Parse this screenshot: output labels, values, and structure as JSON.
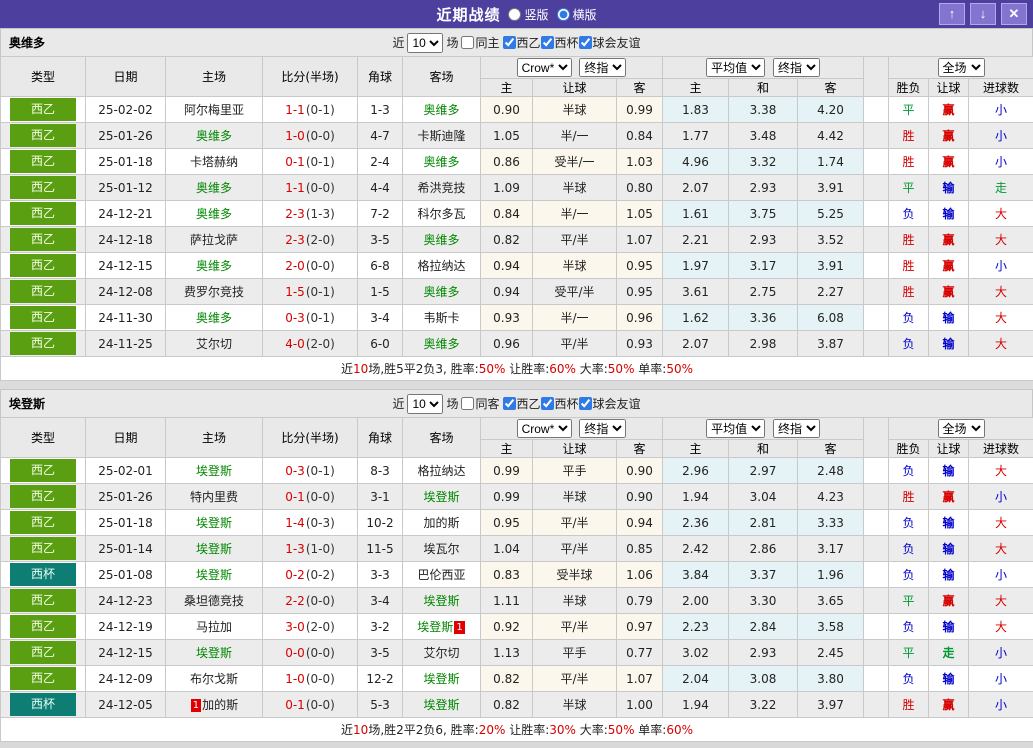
{
  "titlebar": {
    "title": "近期战绩",
    "layout_options": [
      {
        "label": "竖版",
        "selected": false
      },
      {
        "label": "横版",
        "selected": true
      }
    ],
    "buttons": {
      "up": "↑",
      "down": "↓",
      "close": "✕"
    }
  },
  "colors": {
    "header_purple": "#4c3f9e",
    "league_green": "#5a9e11",
    "league_cup_teal": "#0e7d74",
    "team_green": "#008800",
    "win_red": "#d70000",
    "lose_blue": "#0000cc",
    "draw_green": "#009933",
    "crow_columns_bg": "#fcf7ec",
    "avg_columns_bg": "#e6f3f6"
  },
  "columns": {
    "type": "类型",
    "date": "日期",
    "home": "主场",
    "score": "比分(半场)",
    "corner": "角球",
    "away": "客场",
    "crow_select": "Crow*",
    "final_select": "终指",
    "avg_select": "平均值",
    "final_select2": "终指",
    "full_select": "全场",
    "crow_sub": [
      "主",
      "让球",
      "客"
    ],
    "avg_sub": [
      "主",
      "和",
      "客"
    ],
    "full_sub": [
      "胜负",
      "让球",
      "进球数"
    ]
  },
  "tables": [
    {
      "team": "奥维多",
      "filter": {
        "prefix": "近",
        "count": "10",
        "suffix": "场",
        "same": {
          "label": "同主",
          "checked": false
        },
        "leagues": [
          {
            "label": "西乙",
            "checked": true
          },
          {
            "label": "西杯",
            "checked": true
          },
          {
            "label": "球会友谊",
            "checked": true
          }
        ]
      },
      "rows": [
        {
          "league": "西乙",
          "lc": "g",
          "date": "25-02-02",
          "home": {
            "name": "阿尔梅里亚"
          },
          "ft": "1-1",
          "ht": "(0-1)",
          "corners": "1-3",
          "away": {
            "name": "奥维多",
            "green": true
          },
          "crow": [
            "0.90",
            "半球",
            "0.99"
          ],
          "avg": [
            "1.83",
            "3.38",
            "4.20"
          ],
          "results": [
            [
              "平",
              "g"
            ],
            [
              "赢",
              "r"
            ],
            [
              "小",
              "b"
            ]
          ]
        },
        {
          "league": "西乙",
          "lc": "g",
          "date": "25-01-26",
          "home": {
            "name": "奥维多",
            "green": true
          },
          "ft": "1-0",
          "ht": "(0-0)",
          "corners": "4-7",
          "away": {
            "name": "卡斯迪隆"
          },
          "crow": [
            "1.05",
            "半/一",
            "0.84"
          ],
          "avg": [
            "1.77",
            "3.48",
            "4.42"
          ],
          "results": [
            [
              "胜",
              "r"
            ],
            [
              "赢",
              "r"
            ],
            [
              "小",
              "b"
            ]
          ]
        },
        {
          "league": "西乙",
          "lc": "g",
          "date": "25-01-18",
          "home": {
            "name": "卡塔赫纳"
          },
          "ft": "0-1",
          "ht": "(0-1)",
          "corners": "2-4",
          "away": {
            "name": "奥维多",
            "green": true
          },
          "crow": [
            "0.86",
            "受半/一",
            "1.03"
          ],
          "avg": [
            "4.96",
            "3.32",
            "1.74"
          ],
          "results": [
            [
              "胜",
              "r"
            ],
            [
              "赢",
              "r"
            ],
            [
              "小",
              "b"
            ]
          ]
        },
        {
          "league": "西乙",
          "lc": "g",
          "date": "25-01-12",
          "home": {
            "name": "奥维多",
            "green": true
          },
          "ft": "1-1",
          "ht": "(0-0)",
          "corners": "4-4",
          "away": {
            "name": "希洪竞技"
          },
          "crow": [
            "1.09",
            "半球",
            "0.80"
          ],
          "avg": [
            "2.07",
            "2.93",
            "3.91"
          ],
          "results": [
            [
              "平",
              "g"
            ],
            [
              "输",
              "b"
            ],
            [
              "走",
              "g"
            ]
          ]
        },
        {
          "league": "西乙",
          "lc": "g",
          "date": "24-12-21",
          "home": {
            "name": "奥维多",
            "green": true
          },
          "ft": "2-3",
          "ht": "(1-3)",
          "corners": "7-2",
          "away": {
            "name": "科尔多瓦"
          },
          "crow": [
            "0.84",
            "半/一",
            "1.05"
          ],
          "avg": [
            "1.61",
            "3.75",
            "5.25"
          ],
          "results": [
            [
              "负",
              "b"
            ],
            [
              "输",
              "b"
            ],
            [
              "大",
              "r"
            ]
          ]
        },
        {
          "league": "西乙",
          "lc": "g",
          "date": "24-12-18",
          "home": {
            "name": "萨拉戈萨"
          },
          "ft": "2-3",
          "ht": "(2-0)",
          "corners": "3-5",
          "away": {
            "name": "奥维多",
            "green": true
          },
          "crow": [
            "0.82",
            "平/半",
            "1.07"
          ],
          "avg": [
            "2.21",
            "2.93",
            "3.52"
          ],
          "results": [
            [
              "胜",
              "r"
            ],
            [
              "赢",
              "r"
            ],
            [
              "大",
              "r"
            ]
          ]
        },
        {
          "league": "西乙",
          "lc": "g",
          "date": "24-12-15",
          "home": {
            "name": "奥维多",
            "green": true
          },
          "ft": "2-0",
          "ht": "(0-0)",
          "corners": "6-8",
          "away": {
            "name": "格拉纳达"
          },
          "crow": [
            "0.94",
            "半球",
            "0.95"
          ],
          "avg": [
            "1.97",
            "3.17",
            "3.91"
          ],
          "results": [
            [
              "胜",
              "r"
            ],
            [
              "赢",
              "r"
            ],
            [
              "小",
              "b"
            ]
          ]
        },
        {
          "league": "西乙",
          "lc": "g",
          "date": "24-12-08",
          "home": {
            "name": "费罗尔竞技"
          },
          "ft": "1-5",
          "ht": "(0-1)",
          "corners": "1-5",
          "away": {
            "name": "奥维多",
            "green": true
          },
          "crow": [
            "0.94",
            "受平/半",
            "0.95"
          ],
          "avg": [
            "3.61",
            "2.75",
            "2.27"
          ],
          "results": [
            [
              "胜",
              "r"
            ],
            [
              "赢",
              "r"
            ],
            [
              "大",
              "r"
            ]
          ]
        },
        {
          "league": "西乙",
          "lc": "g",
          "date": "24-11-30",
          "home": {
            "name": "奥维多",
            "green": true
          },
          "ft": "0-3",
          "ht": "(0-1)",
          "corners": "3-4",
          "away": {
            "name": "韦斯卡"
          },
          "crow": [
            "0.93",
            "半/一",
            "0.96"
          ],
          "avg": [
            "1.62",
            "3.36",
            "6.08"
          ],
          "results": [
            [
              "负",
              "b"
            ],
            [
              "输",
              "b"
            ],
            [
              "大",
              "r"
            ]
          ]
        },
        {
          "league": "西乙",
          "lc": "g",
          "date": "24-11-25",
          "home": {
            "name": "艾尔切"
          },
          "ft": "4-0",
          "ht": "(2-0)",
          "corners": "6-0",
          "away": {
            "name": "奥维多",
            "green": true
          },
          "crow": [
            "0.96",
            "平/半",
            "0.93"
          ],
          "avg": [
            "2.07",
            "2.98",
            "3.87"
          ],
          "results": [
            [
              "负",
              "b"
            ],
            [
              "输",
              "b"
            ],
            [
              "大",
              "r"
            ]
          ]
        }
      ],
      "summary": [
        [
          "近",
          0
        ],
        [
          "10",
          1
        ],
        [
          "场,胜5平2负3, 胜率:",
          0
        ],
        [
          "50%",
          1
        ],
        [
          " 让胜率:",
          0
        ],
        [
          "60%",
          1
        ],
        [
          " 大率:",
          0
        ],
        [
          "50%",
          1
        ],
        [
          " 单率:",
          0
        ],
        [
          "50%",
          1
        ]
      ]
    },
    {
      "team": "埃登斯",
      "filter": {
        "prefix": "近",
        "count": "10",
        "suffix": "场",
        "same": {
          "label": "同客",
          "checked": false
        },
        "leagues": [
          {
            "label": "西乙",
            "checked": true
          },
          {
            "label": "西杯",
            "checked": true
          },
          {
            "label": "球会友谊",
            "checked": true
          }
        ]
      },
      "rows": [
        {
          "league": "西乙",
          "lc": "g",
          "date": "25-02-01",
          "home": {
            "name": "埃登斯",
            "green": true
          },
          "ft": "0-3",
          "ht": "(0-1)",
          "corners": "8-3",
          "away": {
            "name": "格拉纳达"
          },
          "crow": [
            "0.99",
            "平手",
            "0.90"
          ],
          "avg": [
            "2.96",
            "2.97",
            "2.48"
          ],
          "results": [
            [
              "负",
              "b"
            ],
            [
              "输",
              "b"
            ],
            [
              "大",
              "r"
            ]
          ]
        },
        {
          "league": "西乙",
          "lc": "g",
          "date": "25-01-26",
          "home": {
            "name": "特内里费"
          },
          "ft": "0-1",
          "ht": "(0-0)",
          "corners": "3-1",
          "away": {
            "name": "埃登斯",
            "green": true
          },
          "crow": [
            "0.99",
            "半球",
            "0.90"
          ],
          "avg": [
            "1.94",
            "3.04",
            "4.23"
          ],
          "results": [
            [
              "胜",
              "r"
            ],
            [
              "赢",
              "r"
            ],
            [
              "小",
              "b"
            ]
          ]
        },
        {
          "league": "西乙",
          "lc": "g",
          "date": "25-01-18",
          "home": {
            "name": "埃登斯",
            "green": true
          },
          "ft": "1-4",
          "ht": "(0-3)",
          "corners": "10-2",
          "away": {
            "name": "加的斯"
          },
          "crow": [
            "0.95",
            "平/半",
            "0.94"
          ],
          "avg": [
            "2.36",
            "2.81",
            "3.33"
          ],
          "results": [
            [
              "负",
              "b"
            ],
            [
              "输",
              "b"
            ],
            [
              "大",
              "r"
            ]
          ]
        },
        {
          "league": "西乙",
          "lc": "g",
          "date": "25-01-14",
          "home": {
            "name": "埃登斯",
            "green": true
          },
          "ft": "1-3",
          "ht": "(1-0)",
          "corners": "11-5",
          "away": {
            "name": "埃瓦尔"
          },
          "crow": [
            "1.04",
            "平/半",
            "0.85"
          ],
          "avg": [
            "2.42",
            "2.86",
            "3.17"
          ],
          "results": [
            [
              "负",
              "b"
            ],
            [
              "输",
              "b"
            ],
            [
              "大",
              "r"
            ]
          ]
        },
        {
          "league": "西杯",
          "lc": "t",
          "date": "25-01-08",
          "home": {
            "name": "埃登斯",
            "green": true
          },
          "ft": "0-2",
          "ht": "(0-2)",
          "corners": "3-3",
          "away": {
            "name": "巴伦西亚"
          },
          "crow": [
            "0.83",
            "受半球",
            "1.06"
          ],
          "avg": [
            "3.84",
            "3.37",
            "1.96"
          ],
          "results": [
            [
              "负",
              "b"
            ],
            [
              "输",
              "b"
            ],
            [
              "小",
              "b"
            ]
          ]
        },
        {
          "league": "西乙",
          "lc": "g",
          "date": "24-12-23",
          "home": {
            "name": "桑坦德竞技"
          },
          "ft": "2-2",
          "ht": "(0-0)",
          "corners": "3-4",
          "away": {
            "name": "埃登斯",
            "green": true
          },
          "crow": [
            "1.11",
            "半球",
            "0.79"
          ],
          "avg": [
            "2.00",
            "3.30",
            "3.65"
          ],
          "results": [
            [
              "平",
              "g"
            ],
            [
              "赢",
              "r"
            ],
            [
              "大",
              "r"
            ]
          ]
        },
        {
          "league": "西乙",
          "lc": "g",
          "date": "24-12-19",
          "home": {
            "name": "马拉加"
          },
          "ft": "3-0",
          "ht": "(2-0)",
          "corners": "3-2",
          "away": {
            "name": "埃登斯",
            "green": true,
            "badge": "1",
            "side": "r"
          },
          "crow": [
            "0.92",
            "平/半",
            "0.97"
          ],
          "avg": [
            "2.23",
            "2.84",
            "3.58"
          ],
          "results": [
            [
              "负",
              "b"
            ],
            [
              "输",
              "b"
            ],
            [
              "大",
              "r"
            ]
          ]
        },
        {
          "league": "西乙",
          "lc": "g",
          "date": "24-12-15",
          "home": {
            "name": "埃登斯",
            "green": true
          },
          "ft": "0-0",
          "ht": "(0-0)",
          "corners": "3-5",
          "away": {
            "name": "艾尔切"
          },
          "crow": [
            "1.13",
            "平手",
            "0.77"
          ],
          "avg": [
            "3.02",
            "2.93",
            "2.45"
          ],
          "results": [
            [
              "平",
              "g"
            ],
            [
              "走",
              "g"
            ],
            [
              "小",
              "b"
            ]
          ]
        },
        {
          "league": "西乙",
          "lc": "g",
          "date": "24-12-09",
          "home": {
            "name": "布尔戈斯"
          },
          "ft": "1-0",
          "ht": "(0-0)",
          "corners": "12-2",
          "away": {
            "name": "埃登斯",
            "green": true
          },
          "crow": [
            "0.82",
            "平/半",
            "1.07"
          ],
          "avg": [
            "2.04",
            "3.08",
            "3.80"
          ],
          "results": [
            [
              "负",
              "b"
            ],
            [
              "输",
              "b"
            ],
            [
              "小",
              "b"
            ]
          ]
        },
        {
          "league": "西杯",
          "lc": "t",
          "date": "24-12-05",
          "home": {
            "name": "加的斯",
            "badge": "1",
            "side": "l"
          },
          "ft": "0-1",
          "ht": "(0-0)",
          "corners": "5-3",
          "away": {
            "name": "埃登斯",
            "green": true
          },
          "crow": [
            "0.82",
            "半球",
            "1.00"
          ],
          "avg": [
            "1.94",
            "3.22",
            "3.97"
          ],
          "results": [
            [
              "胜",
              "r"
            ],
            [
              "赢",
              "r"
            ],
            [
              "小",
              "b"
            ]
          ]
        }
      ],
      "summary": [
        [
          "近",
          0
        ],
        [
          "10",
          1
        ],
        [
          "场,胜2平2负6, 胜率:",
          0
        ],
        [
          "20%",
          1
        ],
        [
          " 让胜率:",
          0
        ],
        [
          "30%",
          1
        ],
        [
          " 大率:",
          0
        ],
        [
          "50%",
          1
        ],
        [
          " 单率:",
          0
        ],
        [
          "60%",
          1
        ]
      ]
    }
  ]
}
